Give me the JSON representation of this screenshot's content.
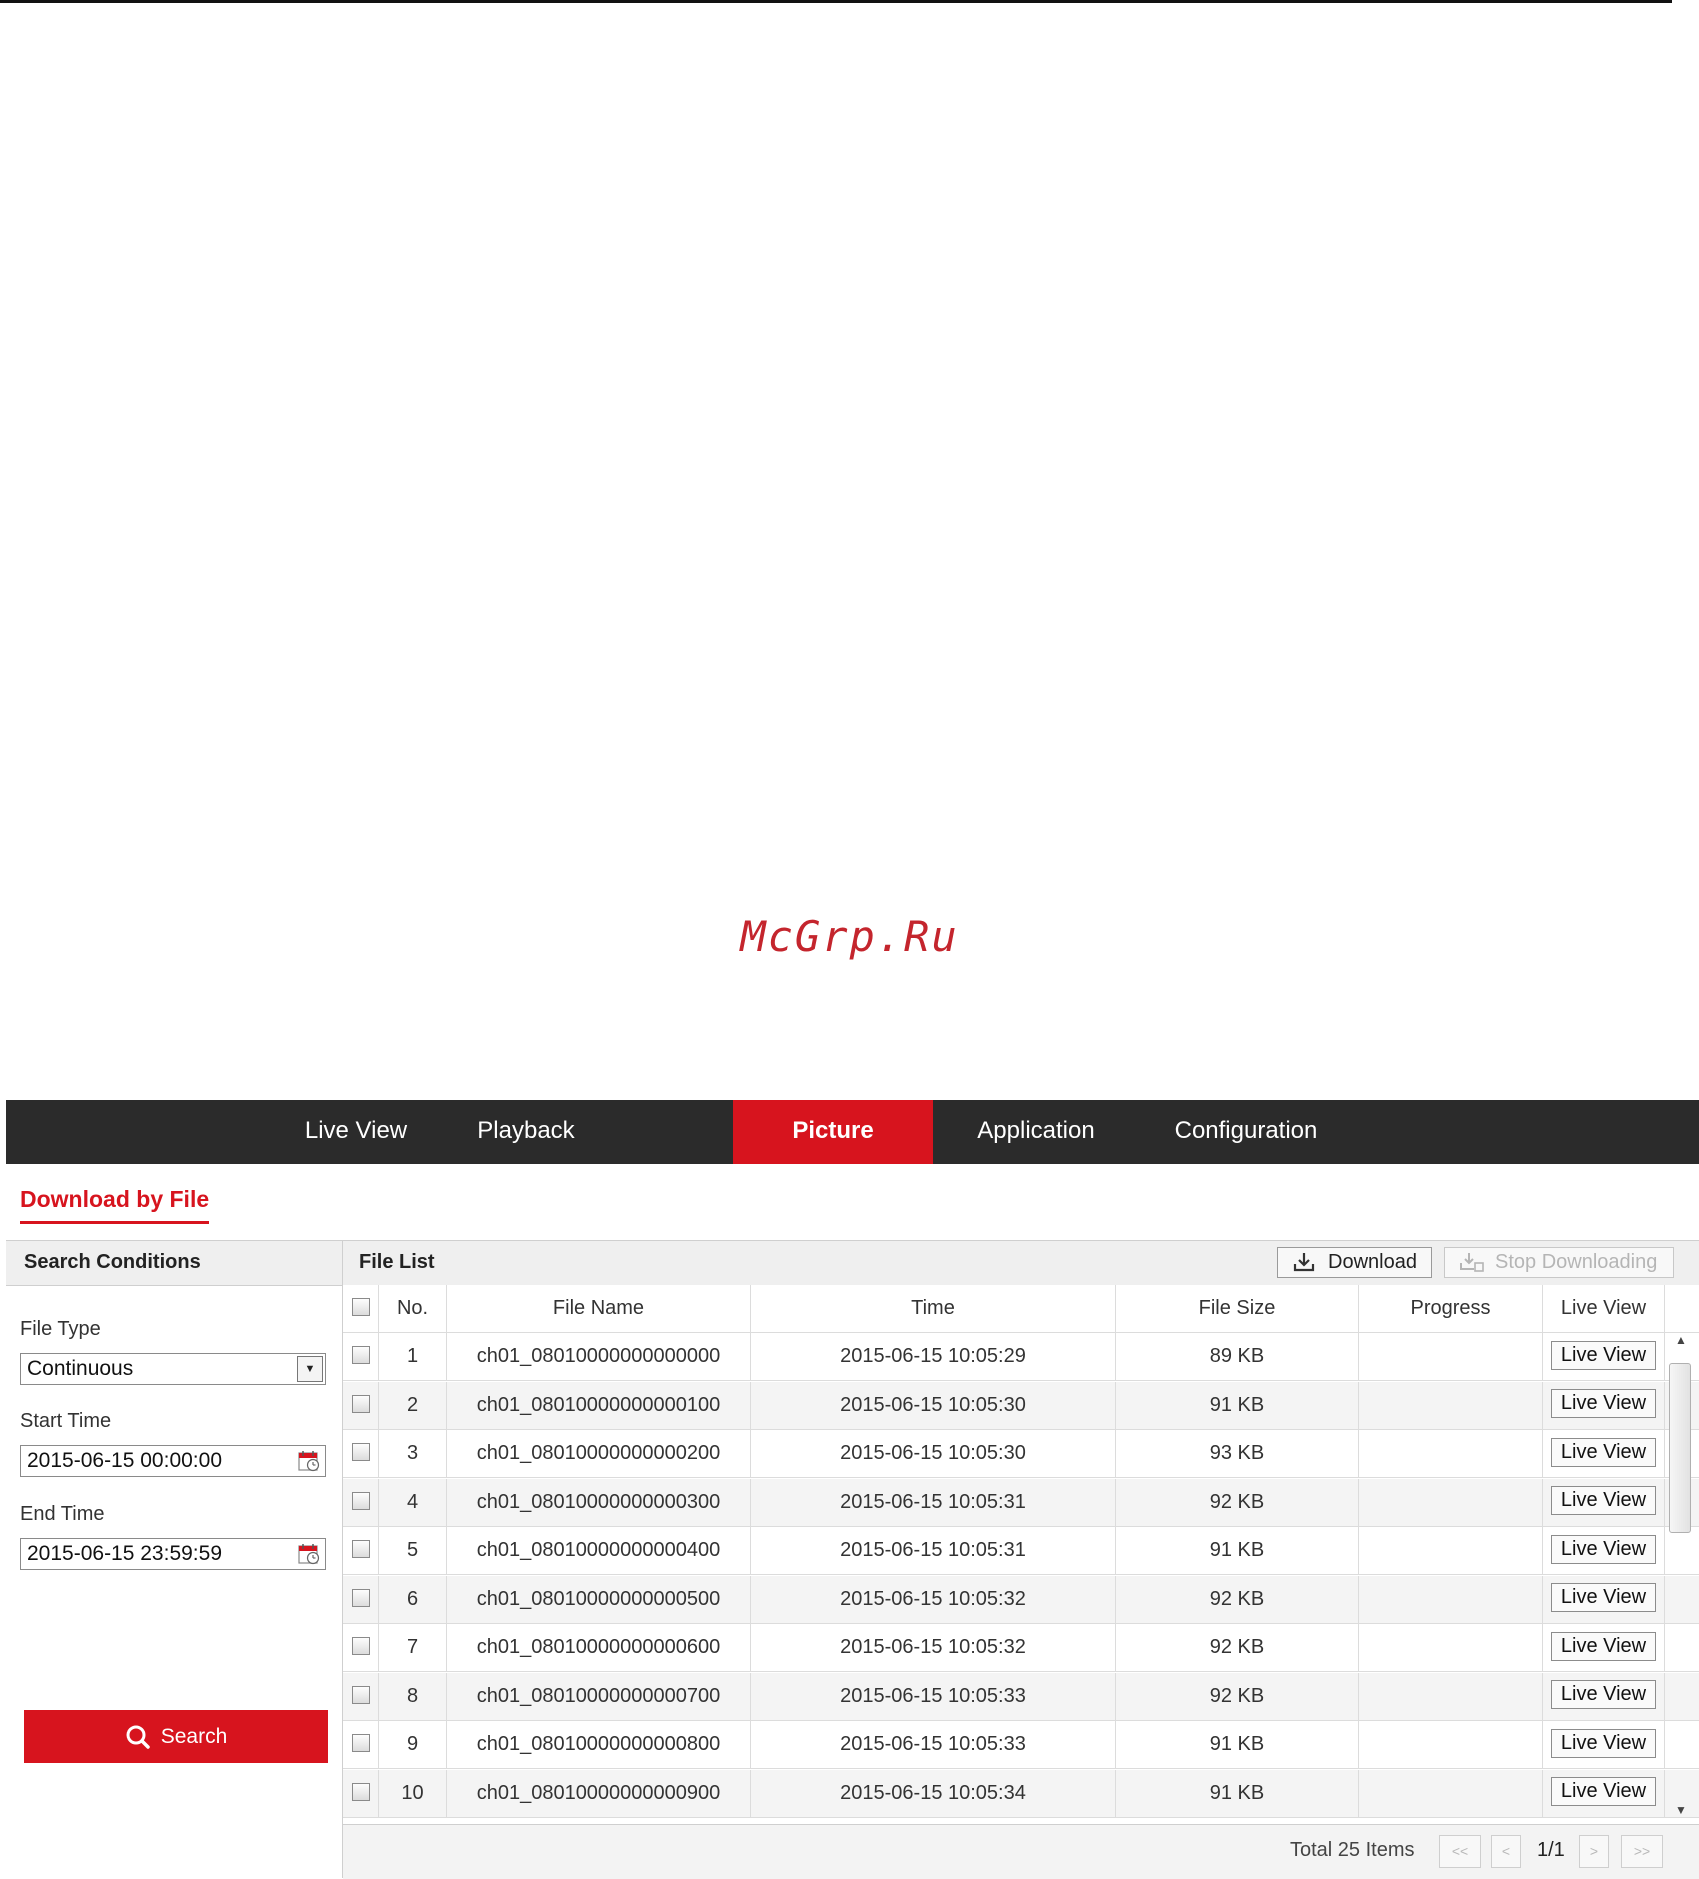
{
  "watermark": "McGrp.Ru",
  "nav": {
    "items": [
      {
        "label": "Live View"
      },
      {
        "label": "Playback"
      },
      {
        "label": "Picture",
        "active": true
      },
      {
        "label": "Application"
      },
      {
        "label": "Configuration"
      }
    ]
  },
  "page_tab": "Download by File",
  "search": {
    "header": "Search Conditions",
    "file_type_label": "File Type",
    "file_type_value": "Continuous",
    "start_time_label": "Start Time",
    "start_time_value": "2015-06-15 00:00:00",
    "end_time_label": "End Time",
    "end_time_value": "2015-06-15 23:59:59",
    "search_label": "Search"
  },
  "file_list": {
    "header": "File List",
    "download_label": "Download",
    "stop_label": "Stop Downloading",
    "columns": {
      "no": "No.",
      "name": "File Name",
      "time": "Time",
      "size": "File Size",
      "progress": "Progress",
      "live": "Live View"
    },
    "rows": [
      {
        "no": "1",
        "name": "ch01_08010000000000000",
        "time": "2015-06-15 10:05:29",
        "size": "89 KB",
        "progress": "",
        "live": "Live View"
      },
      {
        "no": "2",
        "name": "ch01_08010000000000100",
        "time": "2015-06-15 10:05:30",
        "size": "91 KB",
        "progress": "",
        "live": "Live View"
      },
      {
        "no": "3",
        "name": "ch01_08010000000000200",
        "time": "2015-06-15 10:05:30",
        "size": "93 KB",
        "progress": "",
        "live": "Live View"
      },
      {
        "no": "4",
        "name": "ch01_08010000000000300",
        "time": "2015-06-15 10:05:31",
        "size": "92 KB",
        "progress": "",
        "live": "Live View"
      },
      {
        "no": "5",
        "name": "ch01_08010000000000400",
        "time": "2015-06-15 10:05:31",
        "size": "91 KB",
        "progress": "",
        "live": "Live View"
      },
      {
        "no": "6",
        "name": "ch01_08010000000000500",
        "time": "2015-06-15 10:05:32",
        "size": "92 KB",
        "progress": "",
        "live": "Live View"
      },
      {
        "no": "7",
        "name": "ch01_08010000000000600",
        "time": "2015-06-15 10:05:32",
        "size": "92 KB",
        "progress": "",
        "live": "Live View"
      },
      {
        "no": "8",
        "name": "ch01_08010000000000700",
        "time": "2015-06-15 10:05:33",
        "size": "92 KB",
        "progress": "",
        "live": "Live View"
      },
      {
        "no": "9",
        "name": "ch01_08010000000000800",
        "time": "2015-06-15 10:05:33",
        "size": "91 KB",
        "progress": "",
        "live": "Live View"
      },
      {
        "no": "10",
        "name": "ch01_08010000000000900",
        "time": "2015-06-15 10:05:34",
        "size": "91 KB",
        "progress": "",
        "live": "Live View"
      }
    ]
  },
  "pager": {
    "total": "Total 25 Items",
    "first": "<<",
    "prev": "<",
    "page": "1/1",
    "next": ">",
    "last": ">>"
  },
  "colors": {
    "accent": "#d7141e",
    "navbar": "#2b2b2b"
  }
}
